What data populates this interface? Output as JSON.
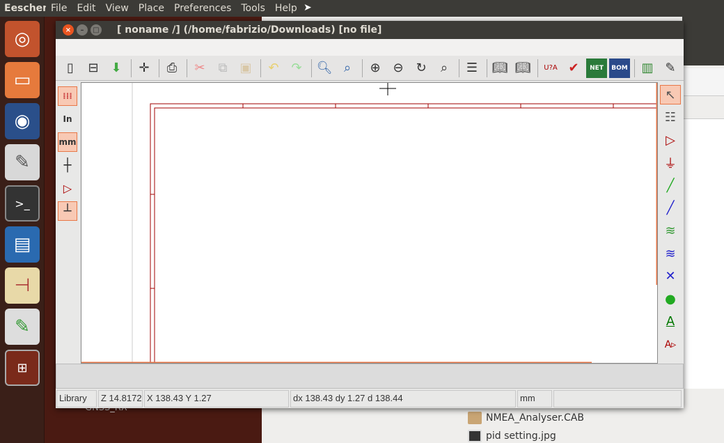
{
  "topbar": {
    "app": "Eeschema",
    "menus": [
      "File",
      "Edit",
      "View",
      "Place",
      "Preferences",
      "Tools",
      "Help"
    ]
  },
  "window": {
    "title": "[ noname /] (/home/fabrizio/Downloads) [no file]"
  },
  "toolbar": [
    "new-sheet",
    "sheet-setup",
    "save",
    "page-settings",
    "print",
    "cut",
    "copy",
    "paste",
    "undo",
    "redo",
    "find",
    "find-replace",
    "zoom-in",
    "zoom-out",
    "redraw",
    "zoom-fit",
    "hierarchy",
    "library-editor",
    "library-browser",
    "annotate",
    "erc",
    "netlist",
    "bom",
    "footprint-assign",
    "pcbnew"
  ],
  "left_toolbar": {
    "in_label": "In",
    "mm_label": "mm"
  },
  "right_toolbar": {
    "text_label": "A",
    "label_label": "A"
  },
  "status": {
    "library": "Library",
    "zoom": "Z 14.8172",
    "xy": "X 138.43  Y 1.27",
    "delta": "dx 138.43  dy 1.27  d 138.44",
    "units": "mm"
  },
  "desktop": {
    "files": [
      "NMEA_Analyser.CAB",
      "pid setting.jpg"
    ],
    "partial": "GNSS_RX"
  },
  "colors": {
    "accent": "#e8784a",
    "sheet": "#a00000"
  }
}
